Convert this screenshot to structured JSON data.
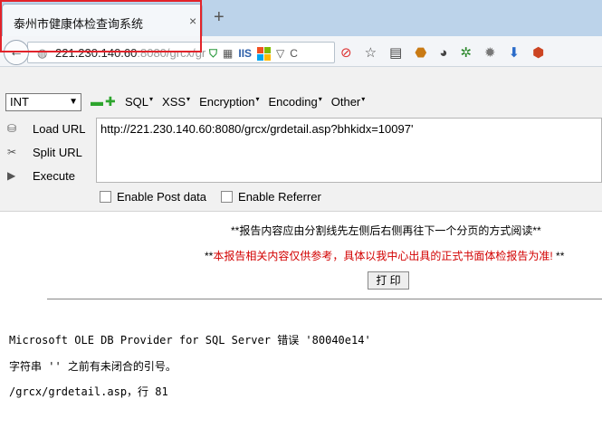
{
  "tab": {
    "title": "泰州市健康体检查询系统",
    "close": "×",
    "new_tab": "+"
  },
  "nav": {
    "back": "←",
    "url_host": "221.230.140.60",
    "url_rest": ":8080/grcx/gr",
    "iis_label": "IIS",
    "reload": "C"
  },
  "hackbar": {
    "int_select": "INT",
    "menus": [
      "SQL",
      "XSS",
      "Encryption",
      "Encoding",
      "Other"
    ],
    "side": [
      {
        "icon": "load-icon",
        "label": "Load URL"
      },
      {
        "icon": "split-icon",
        "label": "Split URL"
      },
      {
        "icon": "execute-icon",
        "label": "Execute"
      }
    ],
    "url_value": "http://221.230.140.60:8080/grcx/grdetail.asp?bhkidx=10097'",
    "enable_post": "Enable Post data",
    "enable_referrer": "Enable Referrer"
  },
  "page": {
    "notice1": "**报告内容应由分割线先左侧后右侧再往下一个分页的方式阅读**",
    "notice2_prefix": "**",
    "notice2_text": "本报告相关内容仅供参考，具体以我中心出具的正式书面体检报告为准!",
    "notice2_suffix": " **",
    "print_button": "打 印",
    "error_line1": "Microsoft OLE DB Provider for SQL Server 错误 '80040e14'",
    "error_line2": "字符串 '' 之前有未闭合的引号。",
    "error_line3": "/grcx/grdetail.asp，行 81"
  },
  "colors": {
    "notice_red": "#d20000",
    "highlight_red": "#e2232a"
  }
}
